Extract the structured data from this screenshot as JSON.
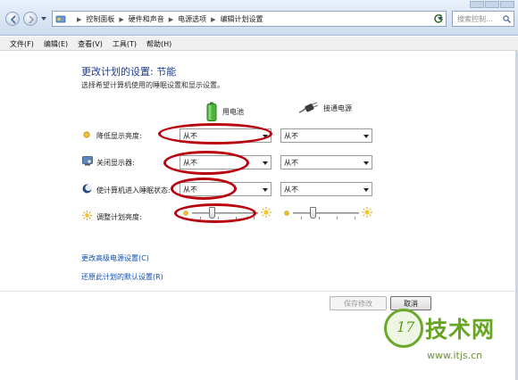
{
  "address": {
    "crumbs": [
      "控制面板",
      "硬件和声音",
      "电源选项",
      "编辑计划设置"
    ],
    "search_placeholder": "搜索控制..."
  },
  "menu": [
    "文件(F)",
    "编辑(E)",
    "查看(V)",
    "工具(T)",
    "帮助(H)"
  ],
  "main": {
    "heading": "更改计划的设置: 节能",
    "subtext": "选择希望计算机使用的睡眠设置和显示设置。",
    "columns": {
      "battery": "用电池",
      "plugged": "接通电源"
    },
    "rows": [
      {
        "label": "降低显示亮度:",
        "battery": "从不",
        "plugged": "从不",
        "icon": "dim-display-icon"
      },
      {
        "label": "关闭显示器:",
        "battery": "从不",
        "plugged": "从不",
        "icon": "monitor-icon"
      },
      {
        "label": "使计算机进入睡眠状态:",
        "battery": "从不",
        "plugged": "从不",
        "icon": "sleep-moon-icon"
      }
    ],
    "brightness": {
      "label": "调整计划亮度:",
      "battery_level": 0.3,
      "plugged_level": 0.3
    },
    "links": {
      "advanced": "更改高级电源设置(C)",
      "restore": "还原此计划的默认设置(R)"
    }
  },
  "buttons": {
    "save": "保存修改",
    "cancel": "取消"
  },
  "watermark": {
    "logo_text": "17",
    "name": "技术网",
    "url": "www.itjs.cn"
  },
  "colors": {
    "annotation": "#b8000e",
    "link": "#0b4eb3",
    "heading": "#1e3a8a"
  }
}
